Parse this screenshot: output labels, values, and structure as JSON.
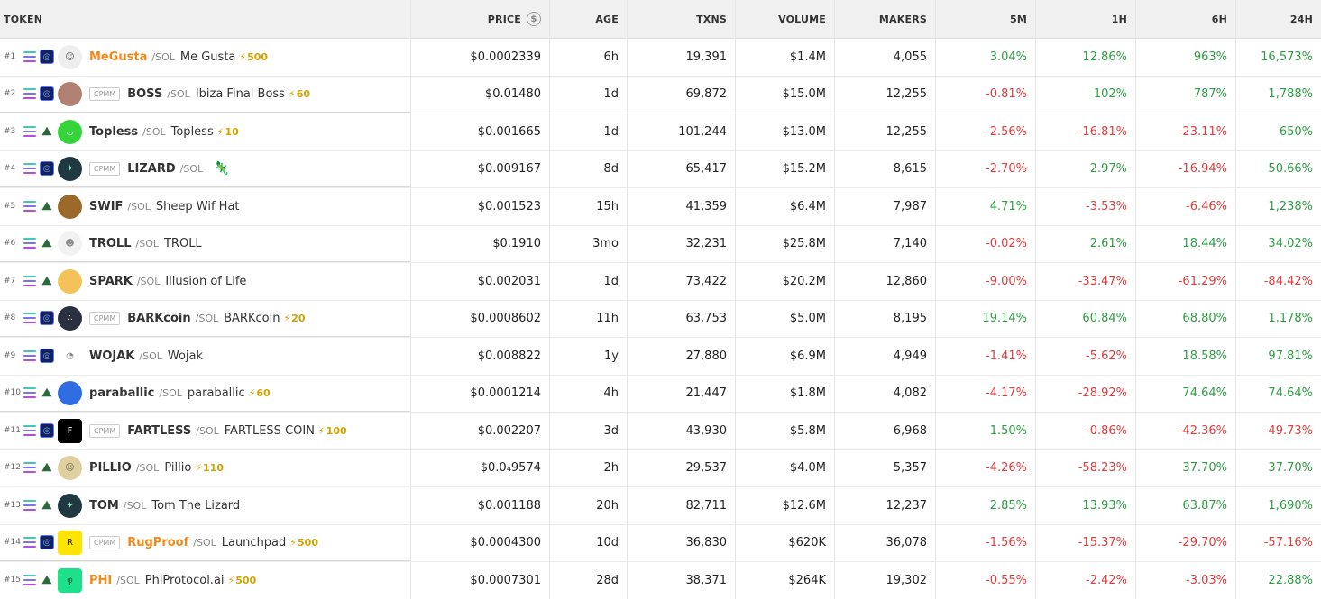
{
  "header": {
    "token": "TOKEN",
    "price": "PRICE",
    "age": "AGE",
    "txns": "TXNS",
    "volume": "VOLUME",
    "makers": "MAKERS",
    "m5": "5M",
    "h1": "1H",
    "h6": "6H",
    "h24": "24H"
  },
  "colors": {
    "positive": "#2e9e44",
    "negative": "#e03c3c",
    "boosted_symbol": "#f08a1c",
    "boost": "#d4a200"
  },
  "rows": [
    {
      "rank": "#1",
      "dex": "raydium-icon",
      "cpmm": "",
      "symbol": "MeGusta",
      "boosted": true,
      "quote": "/SOL",
      "name": "Me Gusta",
      "boost": "500",
      "price": "$0.0002339",
      "age": "6h",
      "txns": "19,391",
      "volume": "$1.4M",
      "makers": "4,055",
      "m5": "3.04%",
      "h1": "12.86%",
      "h6": "963%",
      "h24": "16,573%"
    },
    {
      "rank": "#2",
      "dex": "raydium-icon",
      "cpmm": "CPMM",
      "symbol": "BOSS",
      "boosted": false,
      "quote": "/SOL",
      "name": "Ibiza Final Boss",
      "boost": "60",
      "price": "$0.01480",
      "age": "1d",
      "txns": "69,872",
      "volume": "$15.0M",
      "makers": "12,255",
      "m5": "-0.81%",
      "h1": "102%",
      "h6": "787%",
      "h24": "1,788%"
    },
    {
      "rank": "#3",
      "dex": "mountain-icon",
      "cpmm": "",
      "symbol": "Topless",
      "boosted": false,
      "quote": "/SOL",
      "name": "Topless",
      "boost": "10",
      "price": "$0.001665",
      "age": "1d",
      "txns": "101,244",
      "volume": "$13.0M",
      "makers": "12,255",
      "m5": "-2.56%",
      "h1": "-16.81%",
      "h6": "-23.11%",
      "h24": "650%"
    },
    {
      "rank": "#4",
      "dex": "raydium-icon",
      "cpmm": "CPMM",
      "symbol": "LIZARD",
      "boosted": false,
      "quote": "/SOL",
      "name": "",
      "boost": "",
      "price": "$0.009167",
      "age": "8d",
      "txns": "65,417",
      "volume": "$15.2M",
      "makers": "8,615",
      "m5": "-2.70%",
      "h1": "2.97%",
      "h6": "-16.94%",
      "h24": "50.66%"
    },
    {
      "rank": "#5",
      "dex": "mountain-icon",
      "cpmm": "",
      "symbol": "SWIF",
      "boosted": false,
      "quote": "/SOL",
      "name": "Sheep Wif Hat",
      "boost": "",
      "price": "$0.001523",
      "age": "15h",
      "txns": "41,359",
      "volume": "$6.4M",
      "makers": "7,987",
      "m5": "4.71%",
      "h1": "-3.53%",
      "h6": "-6.46%",
      "h24": "1,238%"
    },
    {
      "rank": "#6",
      "dex": "mountain-icon",
      "cpmm": "",
      "symbol": "TROLL",
      "boosted": false,
      "quote": "/SOL",
      "name": "TROLL",
      "boost": "",
      "price": "$0.1910",
      "age": "3mo",
      "txns": "32,231",
      "volume": "$25.8M",
      "makers": "7,140",
      "m5": "-0.02%",
      "h1": "2.61%",
      "h6": "18.44%",
      "h24": "34.02%"
    },
    {
      "rank": "#7",
      "dex": "mountain-icon",
      "cpmm": "",
      "symbol": "SPARK",
      "boosted": false,
      "quote": "/SOL",
      "name": "Illusion of Life",
      "boost": "",
      "price": "$0.002031",
      "age": "1d",
      "txns": "73,422",
      "volume": "$20.2M",
      "makers": "12,860",
      "m5": "-9.00%",
      "h1": "-33.47%",
      "h6": "-61.29%",
      "h24": "-84.42%"
    },
    {
      "rank": "#8",
      "dex": "raydium-icon",
      "cpmm": "CPMM",
      "symbol": "BARKcoin",
      "boosted": false,
      "quote": "/SOL",
      "name": "BARKcoin",
      "boost": "20",
      "price": "$0.0008602",
      "age": "11h",
      "txns": "63,753",
      "volume": "$5.0M",
      "makers": "8,195",
      "m5": "19.14%",
      "h1": "60.84%",
      "h6": "68.80%",
      "h24": "1,178%"
    },
    {
      "rank": "#9",
      "dex": "raydium-icon",
      "cpmm": "",
      "symbol": "WOJAK",
      "boosted": false,
      "quote": "/SOL",
      "name": "Wojak",
      "boost": "",
      "price": "$0.008822",
      "age": "1y",
      "txns": "27,880",
      "volume": "$6.9M",
      "makers": "4,949",
      "m5": "-1.41%",
      "h1": "-5.62%",
      "h6": "18.58%",
      "h24": "97.81%"
    },
    {
      "rank": "#10",
      "dex": "mountain-icon",
      "cpmm": "",
      "symbol": "paraballic",
      "boosted": false,
      "quote": "/SOL",
      "name": "paraballic",
      "boost": "60",
      "price": "$0.0001214",
      "age": "4h",
      "txns": "21,447",
      "volume": "$1.8M",
      "makers": "4,082",
      "m5": "-4.17%",
      "h1": "-28.92%",
      "h6": "74.64%",
      "h24": "74.64%"
    },
    {
      "rank": "#11",
      "dex": "raydium-icon",
      "cpmm": "CPMM",
      "symbol": "FARTLESS",
      "boosted": false,
      "quote": "/SOL",
      "name": "FARTLESS COIN",
      "boost": "100",
      "price": "$0.002207",
      "age": "3d",
      "txns": "43,930",
      "volume": "$5.8M",
      "makers": "6,968",
      "m5": "1.50%",
      "h1": "-0.86%",
      "h6": "-42.36%",
      "h24": "-49.73%"
    },
    {
      "rank": "#12",
      "dex": "mountain-icon",
      "cpmm": "",
      "symbol": "PILLIO",
      "boosted": false,
      "quote": "/SOL",
      "name": "Pillio",
      "boost": "110",
      "price": "$0.0₄9574",
      "age": "2h",
      "txns": "29,537",
      "volume": "$4.0M",
      "makers": "5,357",
      "m5": "-4.26%",
      "h1": "-58.23%",
      "h6": "37.70%",
      "h24": "37.70%"
    },
    {
      "rank": "#13",
      "dex": "mountain-icon",
      "cpmm": "",
      "symbol": "TOM",
      "boosted": false,
      "quote": "/SOL",
      "name": "Tom The Lizard",
      "boost": "",
      "price": "$0.001188",
      "age": "20h",
      "txns": "82,711",
      "volume": "$12.6M",
      "makers": "12,237",
      "m5": "2.85%",
      "h1": "13.93%",
      "h6": "63.87%",
      "h24": "1,690%"
    },
    {
      "rank": "#14",
      "dex": "raydium-icon",
      "cpmm": "CPMM",
      "symbol": "RugProof",
      "boosted": true,
      "quote": "/SOL",
      "name": "Launchpad",
      "boost": "500",
      "price": "$0.0004300",
      "age": "10d",
      "txns": "36,830",
      "volume": "$620K",
      "makers": "36,078",
      "m5": "-1.56%",
      "h1": "-15.37%",
      "h6": "-29.70%",
      "h24": "-57.16%"
    },
    {
      "rank": "#15",
      "dex": "mountain-icon",
      "cpmm": "",
      "symbol": "PHI",
      "boosted": true,
      "quote": "/SOL",
      "name": "PhiProtocol.ai",
      "boost": "500",
      "price": "$0.0007301",
      "age": "28d",
      "txns": "38,371",
      "volume": "$264K",
      "makers": "19,302",
      "m5": "-0.55%",
      "h1": "-2.42%",
      "h6": "-3.03%",
      "h24": "22.88%"
    }
  ]
}
